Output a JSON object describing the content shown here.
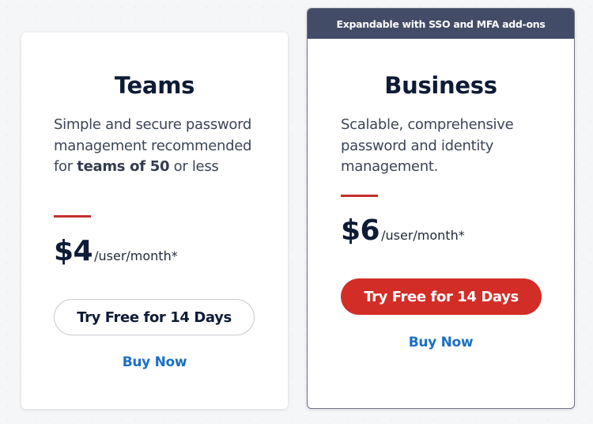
{
  "plans": [
    {
      "name": "Teams",
      "description_parts": {
        "before_bold": "Simple and secure password management recommended for ",
        "bold": "teams of 50",
        "after_bold": " or less"
      },
      "price": "$4",
      "price_unit": "/user/month*",
      "trial_button_label": "Try Free for 14 Days",
      "buy_link_label": "Buy Now"
    },
    {
      "name": "Business",
      "banner": "Expandable with SSO and MFA add-ons",
      "description": "Scalable, comprehensive password and identity management.",
      "price": "$6",
      "price_unit": "/user/month*",
      "trial_button_label": "Try Free for 14 Days",
      "buy_link_label": "Buy Now"
    }
  ],
  "colors": {
    "accent_red": "#d32d27",
    "accent_line": "#c4302b",
    "banner_bg": "#424c67",
    "title_navy": "#0d1b36",
    "link_blue": "#1a6fc4"
  }
}
